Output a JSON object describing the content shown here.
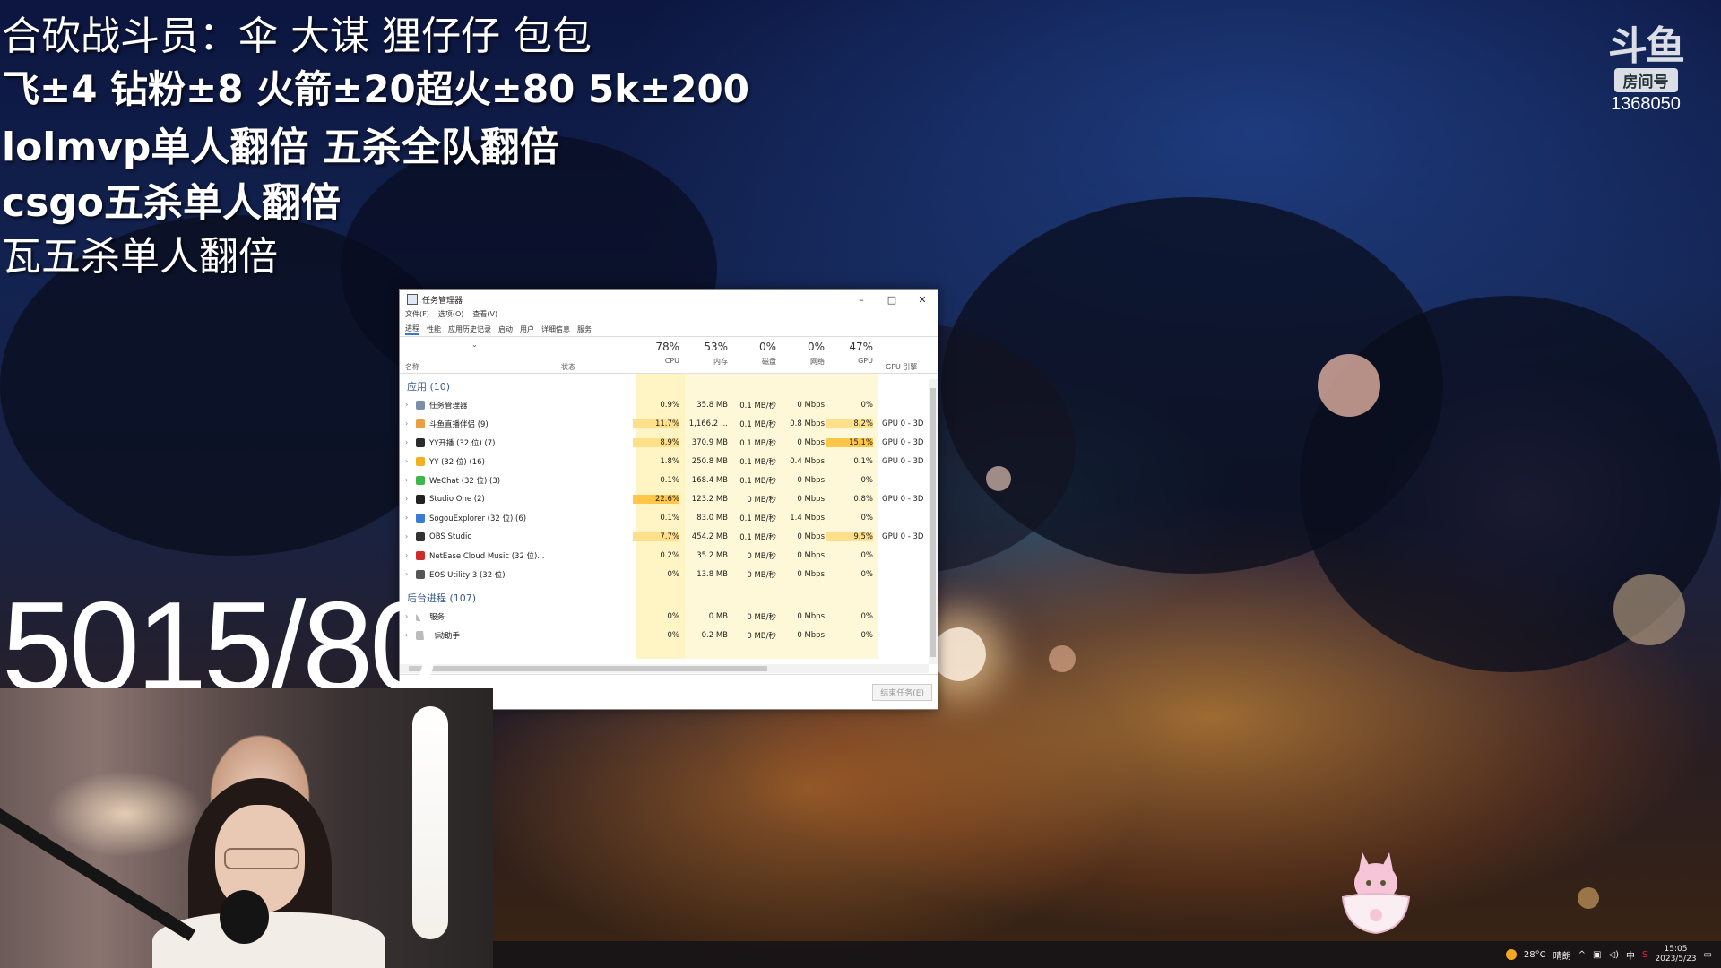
{
  "overlay": {
    "line1": "合砍战斗员：伞 大谋  狸仔仔 包包",
    "line2": "飞±4 钻粉±8 火箭±20超火±80 5k±200",
    "line3": "lolmvp单人翻倍 五杀全队翻倍",
    "line4": "csgo五杀单人翻倍",
    "line5": "瓦五杀单人翻倍",
    "counter": "5015/80"
  },
  "logo": {
    "glyph": "斗鱼",
    "sub": "房间号",
    "room": "1368050"
  },
  "task_manager": {
    "title": "任务管理器",
    "controls": [
      "–",
      "□",
      "✕"
    ],
    "menu": [
      "文件(F)",
      "选项(O)",
      "查看(V)"
    ],
    "tabs": [
      "进程",
      "性能",
      "应用历史记录",
      "启动",
      "用户",
      "详细信息",
      "服务"
    ],
    "header": {
      "name": "名称",
      "status": "状态",
      "cpu_pct": "78%",
      "cpu": "CPU",
      "mem_pct": "53%",
      "mem": "内存",
      "disk_pct": "0%",
      "disk": "磁盘",
      "net_pct": "0%",
      "net": "网络",
      "gpu_pct": "47%",
      "gpu": "GPU",
      "gpu_engine": "GPU 引擎"
    },
    "group_apps": "应用 (10)",
    "group_bg": "后台进程 (107)",
    "rows": [
      {
        "name": "任务管理器",
        "cpu": "0.9%",
        "mem": "35.8 MB",
        "disk": "0.1 MB/秒",
        "net": "0 Mbps",
        "gpu": "0%",
        "engine": ""
      },
      {
        "name": "斗鱼直播伴侣 (9)",
        "cpu": "11.7%",
        "mem": "1,166.2 ...",
        "disk": "0.1 MB/秒",
        "net": "0.8 Mbps",
        "gpu": "8.2%",
        "engine": "GPU 0 - 3D"
      },
      {
        "name": "YY开播 (32 位) (7)",
        "cpu": "8.9%",
        "mem": "370.9 MB",
        "disk": "0.1 MB/秒",
        "net": "0 Mbps",
        "gpu": "15.1%",
        "engine": "GPU 0 - 3D"
      },
      {
        "name": "YY (32 位) (16)",
        "cpu": "1.8%",
        "mem": "250.8 MB",
        "disk": "0.1 MB/秒",
        "net": "0.4 Mbps",
        "gpu": "0.1%",
        "engine": "GPU 0 - 3D"
      },
      {
        "name": "WeChat (32 位) (3)",
        "cpu": "0.1%",
        "mem": "168.4 MB",
        "disk": "0.1 MB/秒",
        "net": "0 Mbps",
        "gpu": "0%",
        "engine": ""
      },
      {
        "name": "Studio One (2)",
        "cpu": "22.6%",
        "mem": "123.2 MB",
        "disk": "0 MB/秒",
        "net": "0 Mbps",
        "gpu": "0.8%",
        "engine": "GPU 0 - 3D"
      },
      {
        "name": "SogouExplorer (32 位) (6)",
        "cpu": "0.1%",
        "mem": "83.0 MB",
        "disk": "0.1 MB/秒",
        "net": "1.4 Mbps",
        "gpu": "0%",
        "engine": ""
      },
      {
        "name": "OBS Studio",
        "cpu": "7.7%",
        "mem": "454.2 MB",
        "disk": "0.1 MB/秒",
        "net": "0 Mbps",
        "gpu": "9.5%",
        "engine": "GPU 0 - 3D"
      },
      {
        "name": "NetEase Cloud Music (32 位)...",
        "cpu": "0.2%",
        "mem": "35.2 MB",
        "disk": "0 MB/秒",
        "net": "0 Mbps",
        "gpu": "0%",
        "engine": ""
      },
      {
        "name": "EOS Utility 3 (32 位)",
        "cpu": "0%",
        "mem": "13.8 MB",
        "disk": "0 MB/秒",
        "net": "0 Mbps",
        "gpu": "0%",
        "engine": ""
      }
    ],
    "bg_rows": [
      {
        "name": "服务",
        "cpu": "0%",
        "mem": "0 MB",
        "disk": "0 MB/秒",
        "net": "0 Mbps",
        "gpu": "0%"
      },
      {
        "name": "启动助手",
        "cpu": "0%",
        "mem": "0.2 MB",
        "disk": "0 MB/秒",
        "net": "0 Mbps",
        "gpu": "0%"
      }
    ],
    "end_task": "结束任务(E)"
  },
  "taskbar": {
    "temperature": "28°C",
    "weather": "晴朗",
    "ime": "中",
    "time": "15:05",
    "date": "2023/5/23"
  },
  "colors": {
    "heat_low": "#fff4c4",
    "heat_mid": "#ffe08a",
    "heat_high": "#ffc64a"
  }
}
